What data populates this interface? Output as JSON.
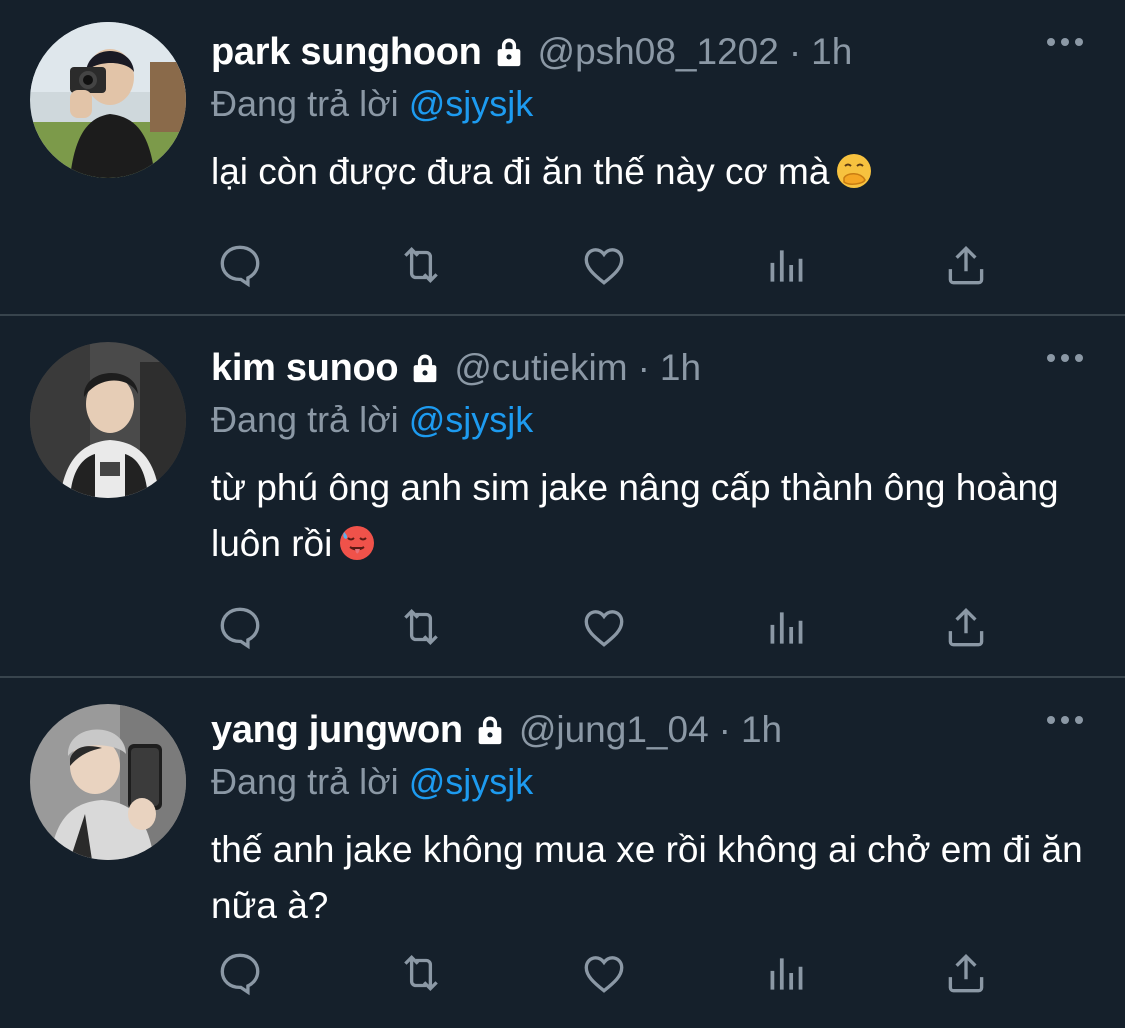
{
  "reply_prefix": "Đang trả lời",
  "colors": {
    "background": "#15202b",
    "divider": "#38444d",
    "muted": "#8b98a5",
    "mention": "#1d9bf0",
    "text": "#ffffff"
  },
  "action_icons": [
    "reply-icon",
    "retweet-icon",
    "like-icon",
    "views-icon",
    "share-icon"
  ],
  "tweets": [
    {
      "name": "park sunghoon",
      "handle": "@psh08_1202",
      "separator": "·",
      "time": "1h",
      "reply_to": "@sjysjk",
      "text": "lại còn được đưa đi ăn thế này cơ mà",
      "emoji": "face-with-hand-over-mouth"
    },
    {
      "name": "kim sunoo",
      "handle": "@cutiekim",
      "separator": "·",
      "time": "1h",
      "reply_to": "@sjysjk",
      "text": "từ phú ông anh sim jake nâng cấp thành ông hoàng luôn rồi",
      "emoji": "hot-face"
    },
    {
      "name": "yang jungwon",
      "handle": "@jung1_04",
      "separator": "·",
      "time": "1h",
      "reply_to": "@sjysjk",
      "text": "thế anh jake không mua xe rồi không ai chở em đi ăn nữa à?",
      "emoji": ""
    }
  ]
}
